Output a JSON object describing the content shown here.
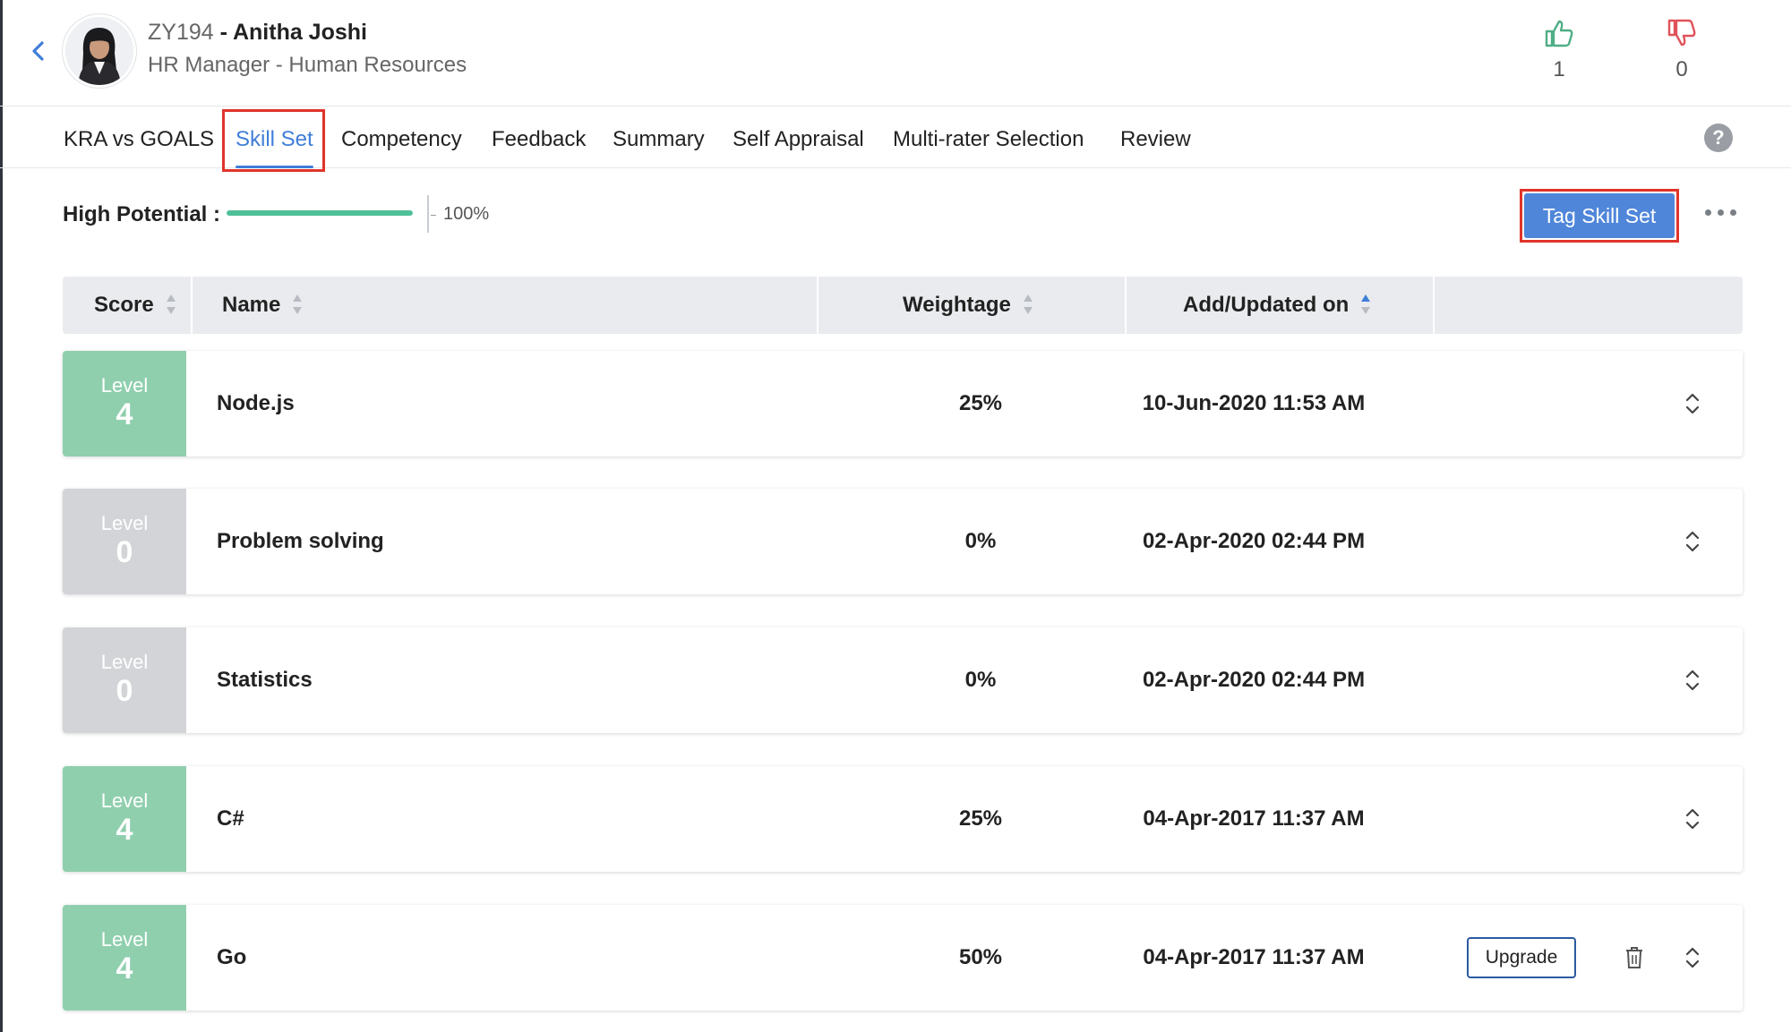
{
  "employee": {
    "id": "ZY194",
    "separator": " - ",
    "name": "Anitha Joshi",
    "role": "HR Manager - Human Resources"
  },
  "votes": {
    "likes": "1",
    "dislikes": "0",
    "like_icon": "thumbs-up-icon",
    "dislike_icon": "thumbs-down-icon"
  },
  "tabs": [
    {
      "label": "KRA vs GOALS"
    },
    {
      "label": "Skill Set",
      "active": true
    },
    {
      "label": "Competency"
    },
    {
      "label": "Feedback"
    },
    {
      "label": "Summary"
    },
    {
      "label": "Self Appraisal"
    },
    {
      "label": "Multi-rater Selection"
    },
    {
      "label": "Review"
    }
  ],
  "help_label": "?",
  "high_potential": {
    "label": "High Potential :",
    "value_text": "100%",
    "percent": 100
  },
  "actions": {
    "tag_skill_set": "Tag Skill Set"
  },
  "table": {
    "headers": {
      "score": "Score",
      "name": "Name",
      "weightage": "Weightage",
      "updated": "Add/Updated on"
    },
    "rows": [
      {
        "level_label": "Level",
        "level": "4",
        "name": "Node.js",
        "weightage": "25%",
        "updated": "10-Jun-2020 11:53 AM"
      },
      {
        "level_label": "Level",
        "level": "0",
        "name": "Problem solving",
        "weightage": "0%",
        "updated": "02-Apr-2020 02:44 PM"
      },
      {
        "level_label": "Level",
        "level": "0",
        "name": "Statistics",
        "weightage": "0%",
        "updated": "02-Apr-2020 02:44 PM"
      },
      {
        "level_label": "Level",
        "level": "4",
        "name": "C#",
        "weightage": "25%",
        "updated": "04-Apr-2017 11:37 AM"
      },
      {
        "level_label": "Level",
        "level": "4",
        "name": "Go",
        "weightage": "50%",
        "updated": "04-Apr-2017 11:37 AM",
        "upgrade_label": "Upgrade"
      }
    ]
  },
  "colors": {
    "accent": "#3f7ed8",
    "button": "#4f86d9",
    "level_good": "#8fcfae",
    "level_none": "#d2d4d7",
    "progress": "#4fbf97",
    "like": "#4fae86",
    "dislike": "#e0525a",
    "highlight": "#e0342b"
  }
}
